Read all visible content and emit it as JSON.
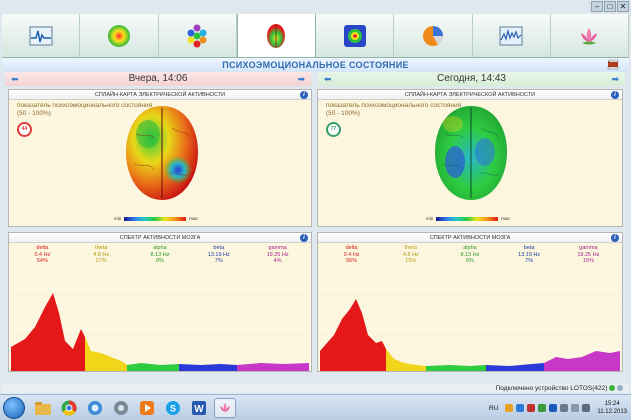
{
  "window": {
    "minimize": "–",
    "maximize": "□",
    "close": "✕"
  },
  "toolbar": {
    "buttons": [
      {
        "name": "ecg-chart-icon",
        "active": false
      },
      {
        "name": "aura-circle-icon",
        "active": false
      },
      {
        "name": "chakra-dots-icon",
        "active": false
      },
      {
        "name": "brain-map-icon",
        "active": true
      },
      {
        "name": "spectrum-box-icon",
        "active": false
      },
      {
        "name": "pie-chart-icon",
        "active": false
      },
      {
        "name": "waveform-chart-icon",
        "active": false
      },
      {
        "name": "lotus-icon",
        "active": false
      }
    ]
  },
  "page_title": "ПСИХОЭМОЦИОНАЛЬНОЕ СОСТОЯНИЕ",
  "left_day": "Вчера, 14:06",
  "right_day": "Сегодня, 14:43",
  "map_header": "СПЛАЙН-КАРТА ЭЛЕКТРИЧЕСКОЙ АКТИВНОСТИ",
  "spectrum_header": "СПЕКТР АКТИВНОСТИ МОЗГА",
  "map_label_line1": "показатель психоэмоционального состояния",
  "map_label_line2": "(50 - 100%)",
  "scale_min": "min",
  "scale_max": "max",
  "left": {
    "badge": "44",
    "bands": [
      {
        "name": "delta",
        "hz": "0.4 Hz",
        "pct": "54%",
        "color": "#d01818"
      },
      {
        "name": "theta",
        "hz": "4.8 Hz",
        "pct": "27%",
        "color": "#b59a10"
      },
      {
        "name": "alpha",
        "hz": "8.13 Hz",
        "pct": "8%",
        "color": "#2a9a2a"
      },
      {
        "name": "beta",
        "hz": "13.19 Hz",
        "pct": "7%",
        "color": "#1a3aa8"
      },
      {
        "name": "gamma",
        "hz": "19.25 Hz",
        "pct": "4%",
        "color": "#a0208a"
      }
    ]
  },
  "right": {
    "badge": "77",
    "bands": [
      {
        "name": "delta",
        "hz": "0.4 Hz",
        "pct": "56%",
        "color": "#d01818"
      },
      {
        "name": "theta",
        "hz": "4.8 Hz",
        "pct": "15%",
        "color": "#b59a10"
      },
      {
        "name": "alpha",
        "hz": "8.13 Hz",
        "pct": "6%",
        "color": "#2a9a2a"
      },
      {
        "name": "beta",
        "hz": "13.19 Hz",
        "pct": "7%",
        "color": "#1a3aa8"
      },
      {
        "name": "gamma",
        "hz": "19.25 Hz",
        "pct": "15%",
        "color": "#a0208a"
      }
    ]
  },
  "status": "Подключено устройство LOTOS(422)",
  "tray": {
    "lang": "RU",
    "time": "15:24",
    "date": "11.12.2013"
  }
}
